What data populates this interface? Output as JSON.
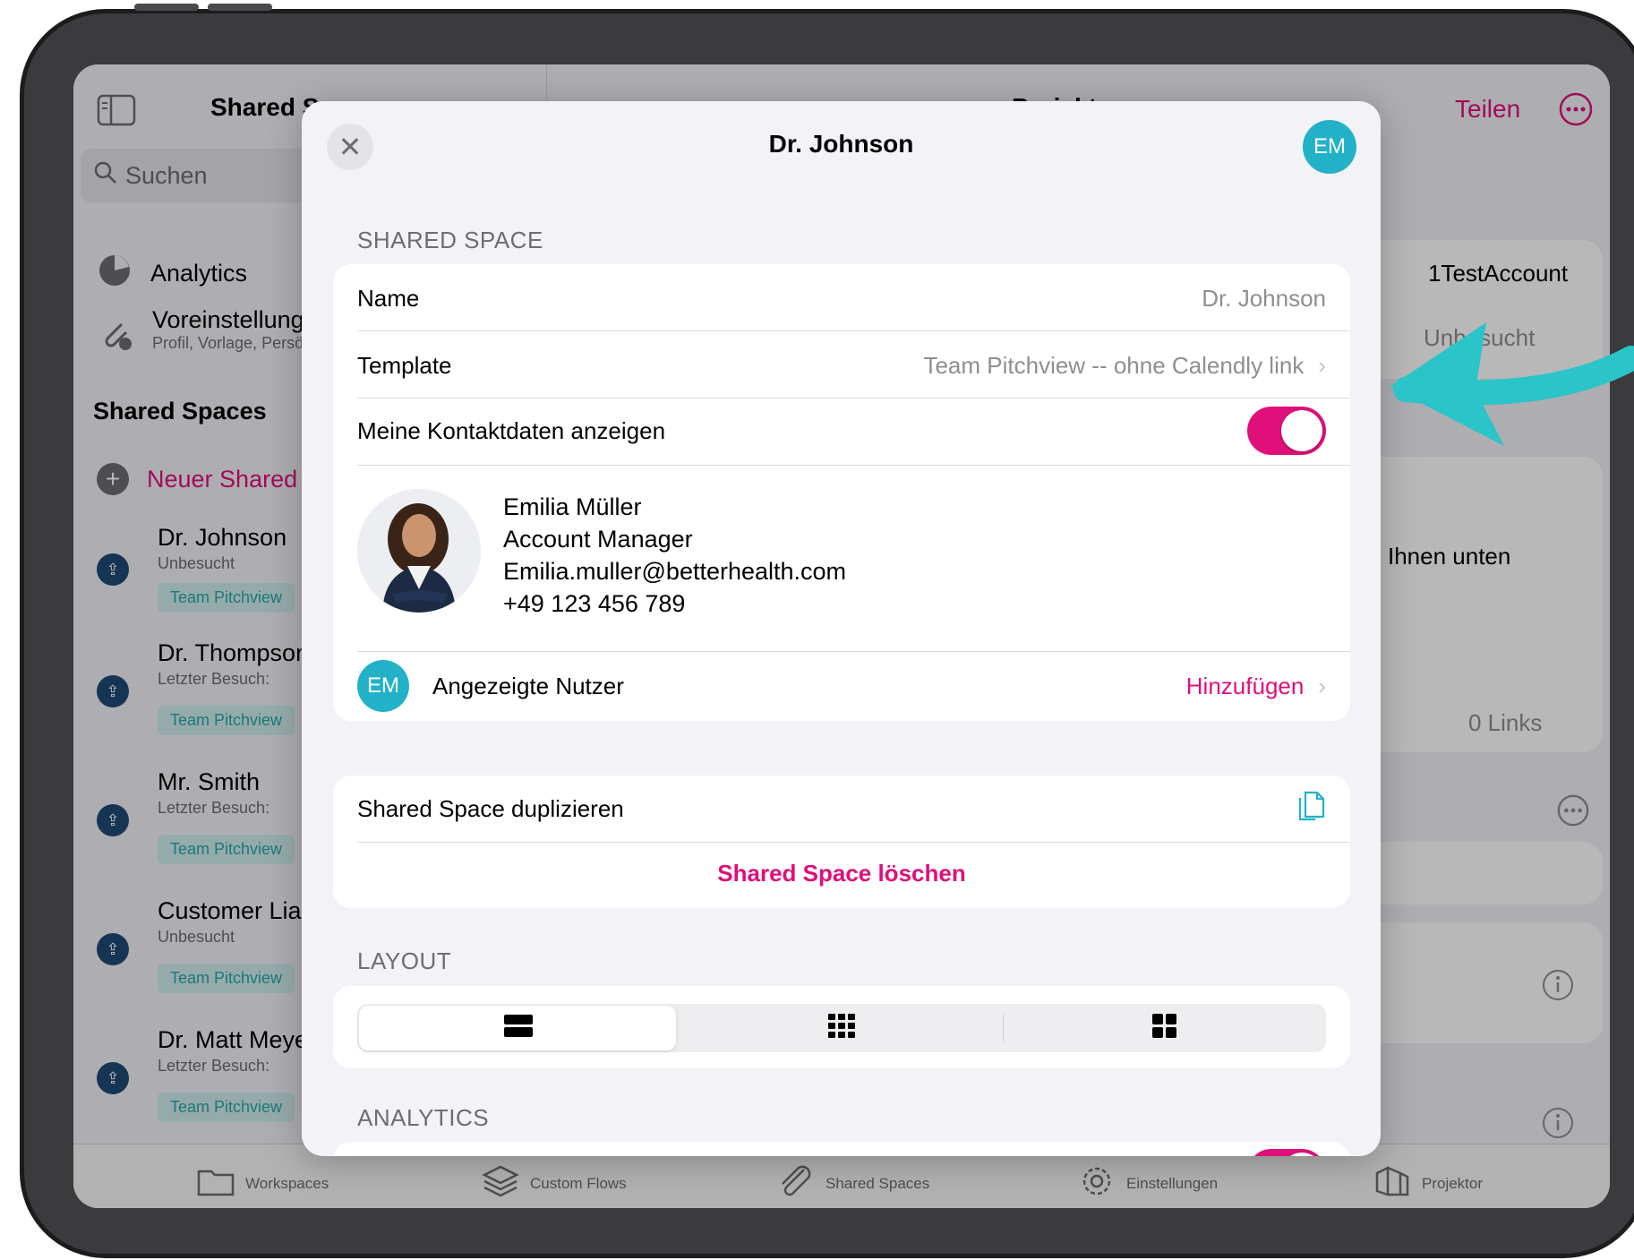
{
  "app": {
    "sidebar": {
      "title": "Shared Spaces",
      "search_placeholder": "Suchen",
      "menu": [
        {
          "label": "Analytics",
          "icon": "pie-chart-icon"
        },
        {
          "label": "Voreinstellungen",
          "sub": "Profil, Vorlage, Persönliche Daten",
          "icon": "paperclip-icon"
        }
      ],
      "section_header": "Shared Spaces",
      "new_label": "Neuer Shared Space",
      "spaces": [
        {
          "name": "Dr. Johnson",
          "status": "Unbesucht",
          "tag": "Team Pitchview"
        },
        {
          "name": "Dr. Thompson",
          "status": "Letzter Besuch:",
          "tag": "Team Pitchview"
        },
        {
          "name": "Mr. Smith",
          "status": "Letzter Besuch:",
          "tag": "Team Pitchview"
        },
        {
          "name": "Customer Liam",
          "status": "Unbesucht",
          "tag": "Team Pitchview"
        },
        {
          "name": "Dr. Matt Meyer",
          "status": "Letzter Besuch:",
          "tag": "Team Pitchview"
        }
      ]
    },
    "main": {
      "title": "Projekt",
      "share_label": "Teilen",
      "account_value": "1TestAccount",
      "status_value": "Unbesucht",
      "info_text": "Ihnen unten",
      "links_value": "0 Links"
    },
    "tabbar": [
      {
        "label": "Workspaces",
        "icon": "folder-icon"
      },
      {
        "label": "Custom Flows",
        "icon": "layers-icon"
      },
      {
        "label": "Shared Spaces",
        "icon": "paperclip-icon"
      },
      {
        "label": "Einstellungen",
        "icon": "gear-icon"
      },
      {
        "label": "Projektor",
        "icon": "projector-icon"
      }
    ]
  },
  "modal": {
    "title": "Dr. Johnson",
    "user_initials": "EM",
    "shared_space_header": "SHARED SPACE",
    "name_label": "Name",
    "name_value": "Dr. Johnson",
    "template_label": "Template",
    "template_value": "Team Pitchview -- ohne Calendly link",
    "contact_toggle_label": "Meine Kontaktdaten anzeigen",
    "contact_toggle_on": true,
    "contact": {
      "name": "Emilia Müller",
      "role": "Account Manager",
      "email": "Emilia.muller@betterhealth.com",
      "phone": "+49 123 456 789"
    },
    "users_label": "Angezeigte Nutzer",
    "users_action": "Hinzufügen",
    "duplicate_label": "Shared Space duplizieren",
    "delete_label": "Shared Space löschen",
    "layout_header": "LAYOUT",
    "layout_options": [
      "list-layout-icon",
      "grid-small-layout-icon",
      "grid-large-layout-icon"
    ],
    "layout_selected": 0,
    "analytics_header": "ANALYTICS"
  },
  "colors": {
    "accent_pink": "#e0107a",
    "avatar_teal": "#22b2c8",
    "arrow_teal": "#2bc4c8"
  }
}
